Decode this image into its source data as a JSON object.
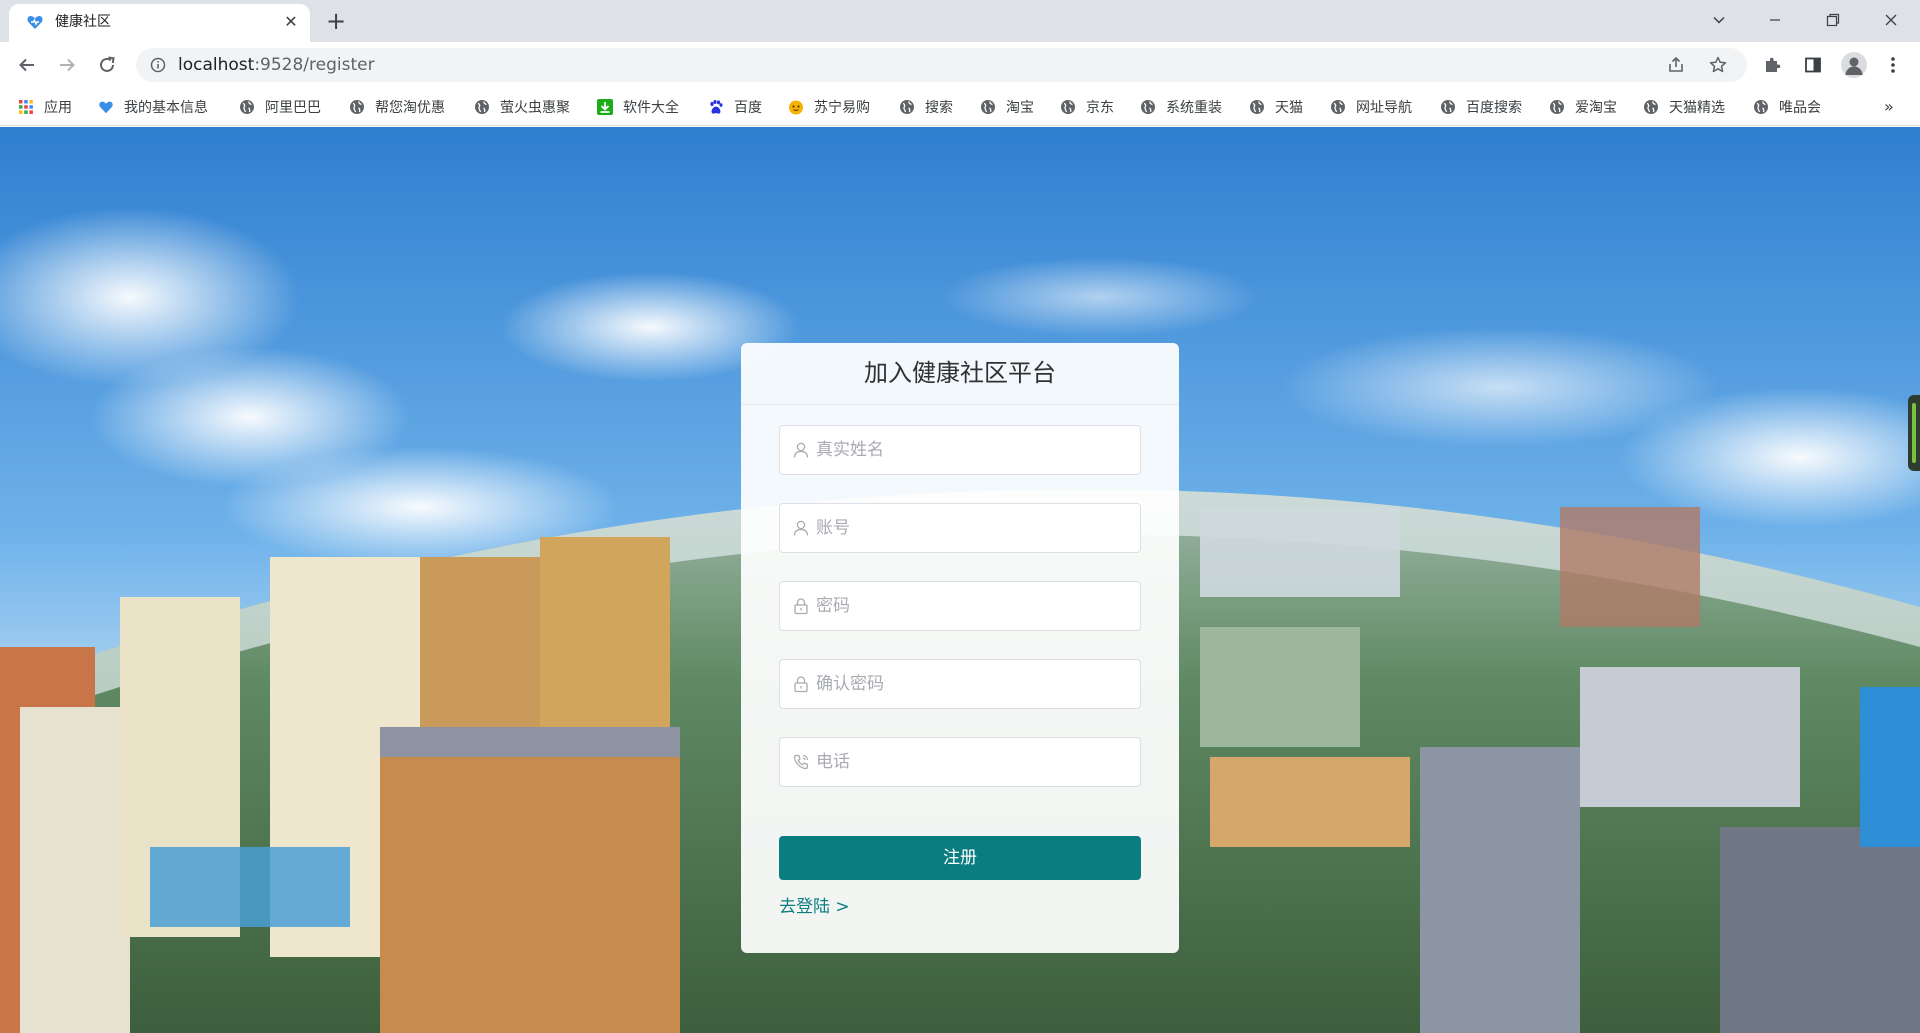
{
  "browser": {
    "tab": {
      "title": "健康社区",
      "close_glyph": "✕",
      "favicon": "heart-logo-icon"
    },
    "new_tab_glyph": "+",
    "address": {
      "host": "localhost",
      "path": ":9528/register"
    }
  },
  "bookmarks": {
    "items": [
      {
        "label": "应用",
        "icon": "apps-grid-icon"
      },
      {
        "label": "我的基本信息",
        "icon": "heart-logo-icon"
      },
      {
        "label": "阿里巴巴",
        "icon": "globe-icon"
      },
      {
        "label": "帮您淘优惠",
        "icon": "globe-icon"
      },
      {
        "label": "萤火虫惠聚",
        "icon": "globe-icon"
      },
      {
        "label": "软件大全",
        "icon": "download-icon"
      },
      {
        "label": "百度",
        "icon": "baidu-paw-icon"
      },
      {
        "label": "苏宁易购",
        "icon": "suning-icon"
      },
      {
        "label": "搜索",
        "icon": "globe-icon"
      },
      {
        "label": "淘宝",
        "icon": "globe-icon"
      },
      {
        "label": "京东",
        "icon": "globe-icon"
      },
      {
        "label": "系统重装",
        "icon": "globe-icon"
      },
      {
        "label": "天猫",
        "icon": "globe-icon"
      },
      {
        "label": "网址导航",
        "icon": "globe-icon"
      },
      {
        "label": "百度搜索",
        "icon": "globe-icon"
      },
      {
        "label": "爱淘宝",
        "icon": "globe-icon"
      },
      {
        "label": "天猫精选",
        "icon": "globe-icon"
      },
      {
        "label": "唯品会",
        "icon": "globe-icon"
      }
    ],
    "more_glyph": "»"
  },
  "register": {
    "title": "加入健康社区平台",
    "fields": {
      "real_name": {
        "placeholder": "真实姓名",
        "icon": "user-icon"
      },
      "account": {
        "placeholder": "账号",
        "icon": "user-icon"
      },
      "password": {
        "placeholder": "密码",
        "icon": "lock-icon"
      },
      "confirm_password": {
        "placeholder": "确认密码",
        "icon": "lock-icon"
      },
      "phone": {
        "placeholder": "电话",
        "icon": "phone-icon"
      }
    },
    "submit_label": "注册",
    "login_link": "去登陆 >"
  },
  "colors": {
    "primary": "#0b7d80",
    "sky": "#3d8fd6",
    "chrome_bg": "#dee1e6"
  }
}
